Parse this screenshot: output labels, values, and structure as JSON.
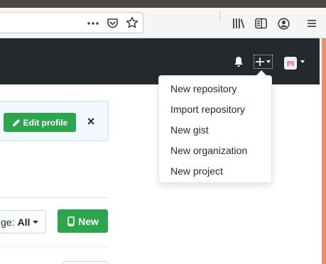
{
  "browser": {
    "icons": [
      "more-dots-icon",
      "pocket-icon",
      "bookmark-star-icon",
      "library-icon",
      "sidebar-icon",
      "account-icon",
      "hamburger-menu-icon"
    ]
  },
  "header": {
    "icons": [
      "notification-bell-icon",
      "plus-icon",
      "avatar"
    ]
  },
  "profile_notice": {
    "edit_label": "Edit profile",
    "close_glyph": "×"
  },
  "repo_filters": {
    "language_prefix": "ge:",
    "language_value": "All",
    "new_label": "New"
  },
  "create_menu": {
    "items": [
      {
        "label": "New repository"
      },
      {
        "label": "Import repository"
      },
      {
        "label": "New gist"
      },
      {
        "label": "New organization"
      },
      {
        "label": "New project"
      }
    ]
  },
  "colors": {
    "header_bg": "#24292e",
    "primary_green": "#2ea44f",
    "notice_bg": "#f1f8ff",
    "edge_accent": "#ec8f66"
  }
}
